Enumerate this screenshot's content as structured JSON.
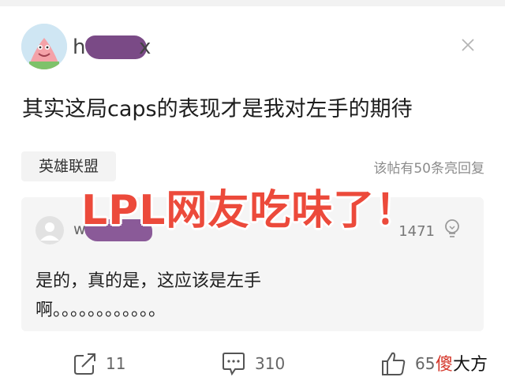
{
  "post": {
    "username_visible_start": "h",
    "username_visible_end": "x",
    "title": "其实这局caps的表现才是我对左手的期待",
    "tag": "英雄联盟",
    "reply_count_text": "该帖有50条亮回复"
  },
  "overlay": {
    "caption": "LPL网友吃味了！",
    "color": "#ec4a3b"
  },
  "comment": {
    "username_visible_start": "w",
    "likes": "1471",
    "text_line1": "是的，真的是，这应该是左手",
    "text_line2": "啊。。。。。。。。。。。。"
  },
  "actions": {
    "share_count": "11",
    "comment_count": "310",
    "like_count": "65"
  },
  "watermark": {
    "red_char": "傻",
    "rest": "大方"
  },
  "icons": {
    "close": "close-icon",
    "share": "share-icon",
    "comment": "comment-icon",
    "like": "thumbs-up-icon",
    "bulb": "lightbulb-icon"
  }
}
